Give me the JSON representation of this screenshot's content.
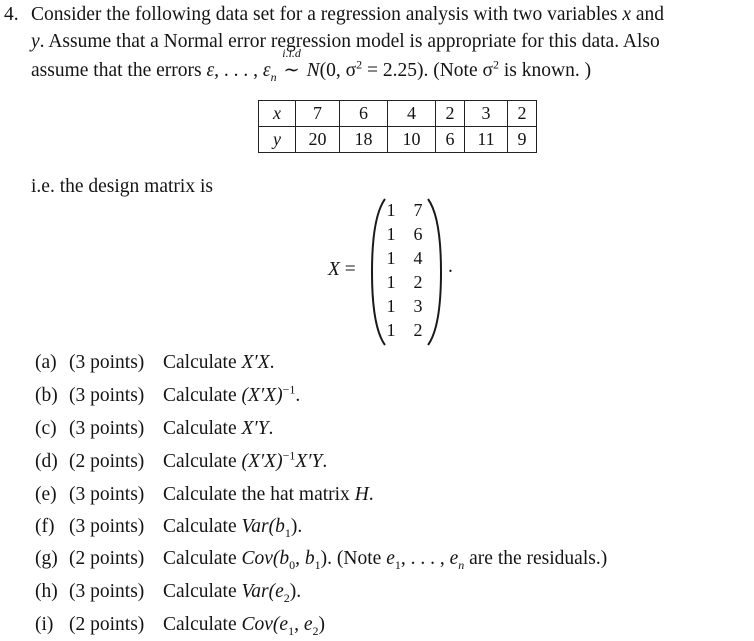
{
  "problem": {
    "number": "4.",
    "line1_a": "Consider the following data set for a regression analysis with two variables ",
    "line1_var": "x",
    "line1_b": " and",
    "line2_var": "y",
    "line2_b": ". Assume that a Normal error regression model is appropriate for this data. Also",
    "line3_a": "assume that the errors ",
    "errors_first": "ε",
    "errors_dots": ", . . . , ",
    "errors_last": "ε",
    "errors_last_sub": "n",
    "iid_label": "i.i.d",
    "iid_symbol": "∼",
    "dist": "N",
    "dist_args": "(0, σ",
    "dist_sup": "2",
    "dist_tail": " = 2.25). (Note σ",
    "note_sup": "2",
    "note_tail": " is known. )"
  },
  "table": {
    "x_label": "x",
    "y_label": "y",
    "x_values": [
      "7",
      "6",
      "4",
      "2",
      "3",
      "2"
    ],
    "y_values": [
      "20",
      "18",
      "10",
      "6",
      "11",
      "9"
    ]
  },
  "design": {
    "intro": "i.e. the design matrix is",
    "lhs": "X",
    "eq": " =",
    "col1": [
      "1",
      "1",
      "1",
      "1",
      "1",
      "1"
    ],
    "col2": [
      "7",
      "6",
      "4",
      "2",
      "3",
      "2"
    ],
    "period": "."
  },
  "parts": [
    {
      "label": "(a)",
      "points": "(3 points)",
      "text": "Calculate ",
      "math": "X′X",
      "tail": "."
    },
    {
      "label": "(b)",
      "points": "(3 points)",
      "text": "Calculate ",
      "math": "(X′X)",
      "sup": "−1",
      "tail": "."
    },
    {
      "label": "(c)",
      "points": "(3 points)",
      "text": "Calculate ",
      "math": "X′Y",
      "tail": "."
    },
    {
      "label": "(d)",
      "points": "(2 points)",
      "text": "Calculate ",
      "math": "(X′X)",
      "sup": "−1",
      "math2": "X′Y",
      "tail": "."
    },
    {
      "label": "(e)",
      "points": "(3 points)",
      "text": "Calculate the hat matrix ",
      "math": "H",
      "tail": "."
    },
    {
      "label": "(f)",
      "points": "(3 points)",
      "text": "Calculate ",
      "math": "Var(b",
      "sub": "1",
      "tail": ")."
    },
    {
      "label": "(g)",
      "points": "(2 points)",
      "text": "Calculate ",
      "math": "Cov(b",
      "sub": "0",
      "mid": ", b",
      "sub2": "1",
      "tail": "). (Note ",
      "note_a": "e",
      "note_a_sub": "1",
      "note_dots": ", . . . , ",
      "note_b": "e",
      "note_b_sub": "n",
      "note_tail": " are the residuals.)"
    },
    {
      "label": "(h)",
      "points": "(3 points)",
      "text": "Calculate ",
      "math": "Var(e",
      "sub": "2",
      "tail": ")."
    },
    {
      "label": "(i)",
      "points": "(2 points)",
      "text": "Calculate ",
      "math": "Cov(e",
      "sub": "1",
      "mid": ", e",
      "sub2": "2",
      "tail": ")"
    }
  ]
}
